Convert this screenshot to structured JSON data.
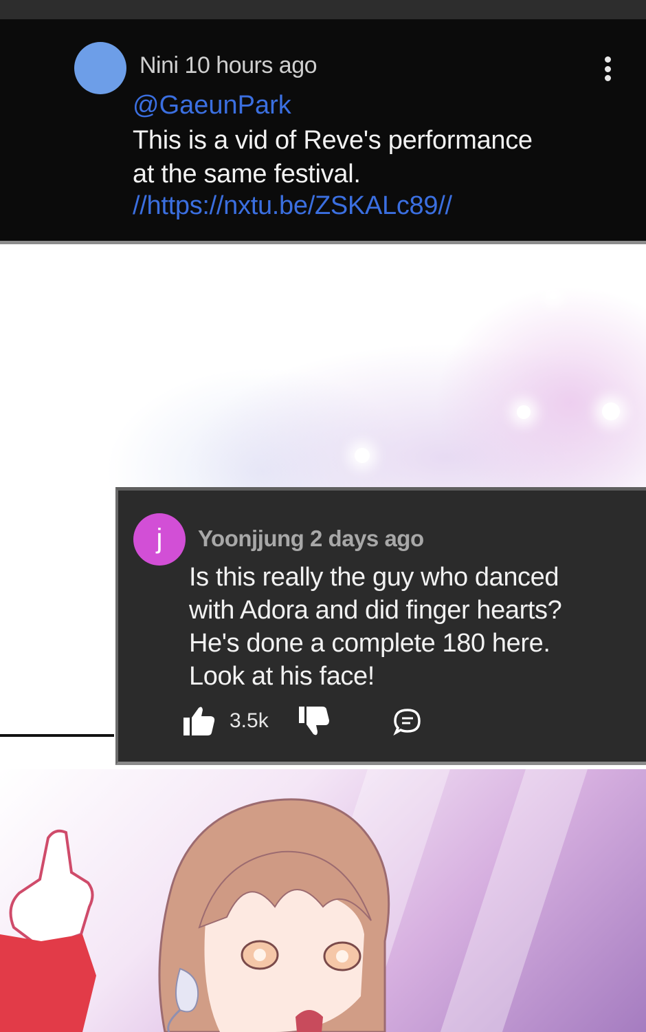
{
  "top_comment": {
    "author": "Nini",
    "time": "10 hours ago",
    "mention": "@GaeunPark",
    "body_line1": "This is a vid of Reve's performance",
    "body_line2": "at the same festival.",
    "link": "//https://nxtu.be/ZSKALc89//",
    "avatar_color": "#6d9ee8"
  },
  "reply_comment": {
    "avatar_letter": "j",
    "avatar_color": "#d24fd6",
    "author": "Yoonjjung",
    "time": "2 days ago",
    "body_lines": [
      "Is this really the guy who danced",
      "with Adora and did finger hearts?",
      "He's done a complete 180 here.",
      "Look at his face!"
    ],
    "like_count": "3.5k",
    "icons": [
      "thumb-up-icon",
      "thumb-down-icon",
      "reply-icon"
    ]
  },
  "colors": {
    "link": "#3b6fe0",
    "card_background": "#2b2b2b",
    "top_background": "#0b0b0b"
  }
}
